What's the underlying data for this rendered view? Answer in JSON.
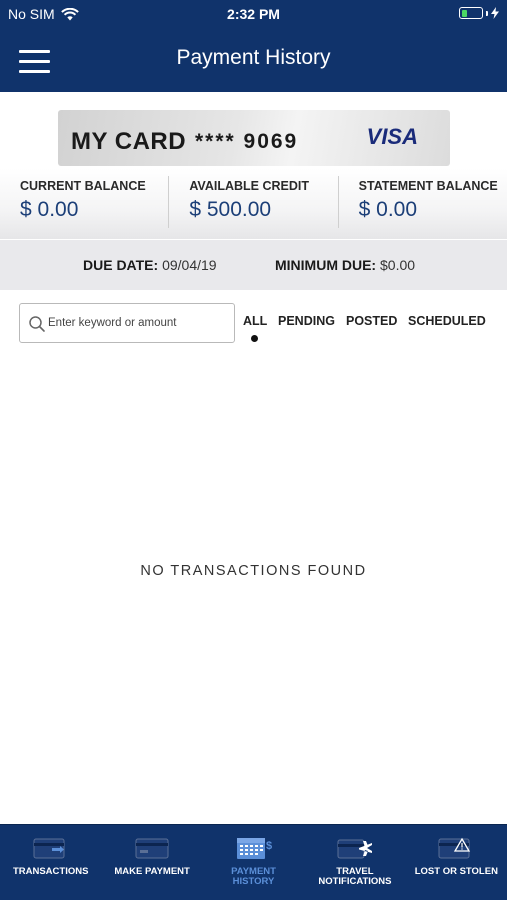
{
  "status_bar": {
    "carrier": "No SIM",
    "time": "2:32 PM"
  },
  "header": {
    "title": "Payment History",
    "menu_icon": "hamburger-menu-icon"
  },
  "card": {
    "name": "MY CARD",
    "masked_number": "**** 9069",
    "brand": "VISA"
  },
  "balances": [
    {
      "label": "CURRENT BALANCE",
      "value": "$ 0.00"
    },
    {
      "label": "AVAILABLE CREDIT",
      "value": "$ 500.00"
    },
    {
      "label": "STATEMENT BALANCE",
      "value": "$ 0.00"
    }
  ],
  "due": {
    "date_label": "DUE DATE:",
    "date_value": "09/04/19",
    "min_label": "MINIMUM DUE:",
    "min_value": "$0.00"
  },
  "search": {
    "placeholder": "Enter keyword or amount"
  },
  "filters": {
    "items": [
      "ALL",
      "PENDING",
      "POSTED",
      "SCHEDULED"
    ],
    "selected": "ALL"
  },
  "empty_message": "NO TRANSACTIONS FOUND",
  "tabs": [
    {
      "label": "TRANSACTIONS",
      "icon": "card-transactions-icon"
    },
    {
      "label": "MAKE PAYMENT",
      "icon": "card-payment-icon"
    },
    {
      "label": "PAYMENT\nHISTORY",
      "icon": "calendar-dollar-icon",
      "active": true
    },
    {
      "label": "TRAVEL\nNOTIFICATIONS",
      "icon": "card-plane-icon"
    },
    {
      "label": "LOST OR STOLEN",
      "icon": "card-warning-icon"
    }
  ],
  "colors": {
    "primary": "#10336b",
    "accent_value": "#1c3f78",
    "active_tab": "#5b8fd8",
    "due_bar": "#e9e9ec"
  }
}
